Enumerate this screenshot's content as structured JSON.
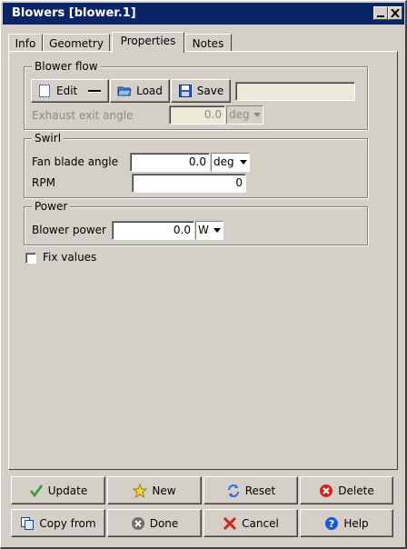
{
  "window": {
    "title": "Blowers [blower.1]"
  },
  "tabs": [
    {
      "label": "Info",
      "active": false
    },
    {
      "label": "Geometry",
      "active": false
    },
    {
      "label": "Properties",
      "active": true
    },
    {
      "label": "Notes",
      "active": false
    }
  ],
  "blower_flow": {
    "title": "Blower flow",
    "edit_label": "Edit",
    "load_label": "Load",
    "save_label": "Save",
    "file_value": "",
    "exhaust_label": "Exhaust exit angle",
    "exhaust_value": "0.0",
    "exhaust_unit": "deg"
  },
  "swirl": {
    "title": "Swirl",
    "fan_blade_label": "Fan blade angle",
    "fan_blade_value": "0.0",
    "fan_blade_unit": "deg",
    "rpm_label": "RPM",
    "rpm_value": "0"
  },
  "power": {
    "title": "Power",
    "blower_power_label": "Blower power",
    "blower_power_value": "0.0",
    "blower_power_unit": "W"
  },
  "fix_values": {
    "label": "Fix values",
    "checked": false
  },
  "actions": {
    "update": "Update",
    "new": "New",
    "reset": "Reset",
    "delete": "Delete",
    "copy_from": "Copy from",
    "done": "Done",
    "cancel": "Cancel",
    "help": "Help"
  },
  "colors": {
    "titlebar": "#0a246a",
    "face": "#d4d0c8",
    "disabled_field": "#ece9d8"
  }
}
